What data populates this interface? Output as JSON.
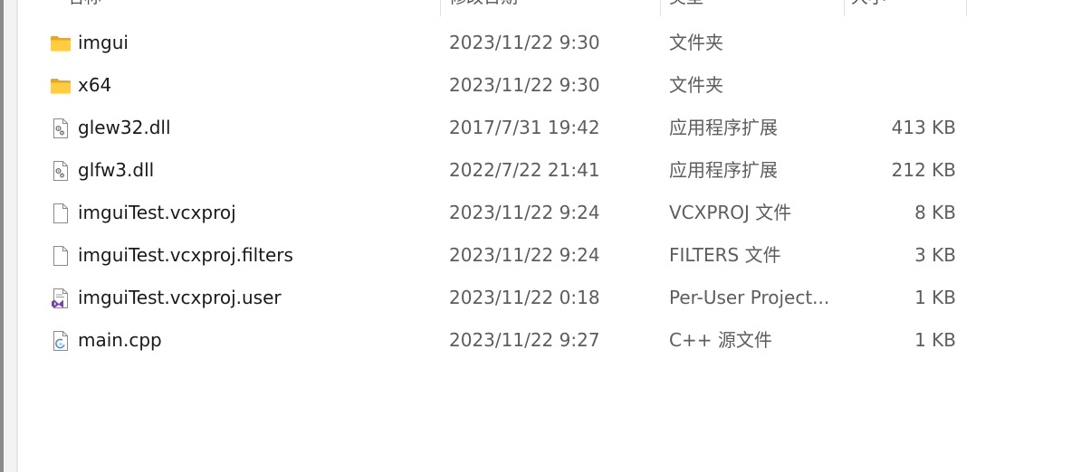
{
  "header": {
    "name_label": "名称",
    "date_label": "修改日期",
    "type_label": "类型",
    "size_label": "大小"
  },
  "files": [
    {
      "icon": "folder-icon",
      "name": "imgui",
      "date": "2023/11/22 9:30",
      "type": "文件夹",
      "size": ""
    },
    {
      "icon": "folder-icon",
      "name": "x64",
      "date": "2023/11/22 9:30",
      "type": "文件夹",
      "size": ""
    },
    {
      "icon": "dll-file-icon",
      "name": "glew32.dll",
      "date": "2017/7/31 19:42",
      "type": "应用程序扩展",
      "size": "413 KB"
    },
    {
      "icon": "dll-file-icon",
      "name": "glfw3.dll",
      "date": "2022/7/22 21:41",
      "type": "应用程序扩展",
      "size": "212 KB"
    },
    {
      "icon": "generic-file-icon",
      "name": "imguiTest.vcxproj",
      "date": "2023/11/22 9:24",
      "type": "VCXPROJ 文件",
      "size": "8 KB"
    },
    {
      "icon": "generic-file-icon",
      "name": "imguiTest.vcxproj.filters",
      "date": "2023/11/22 9:24",
      "type": "FILTERS 文件",
      "size": "3 KB"
    },
    {
      "icon": "visual-studio-file-icon",
      "name": "imguiTest.vcxproj.user",
      "date": "2023/11/22 0:18",
      "type": "Per-User Project...",
      "size": "1 KB"
    },
    {
      "icon": "cpp-file-icon",
      "name": "main.cpp",
      "date": "2023/11/22 9:27",
      "type": "C++ 源文件",
      "size": "1 KB"
    }
  ]
}
